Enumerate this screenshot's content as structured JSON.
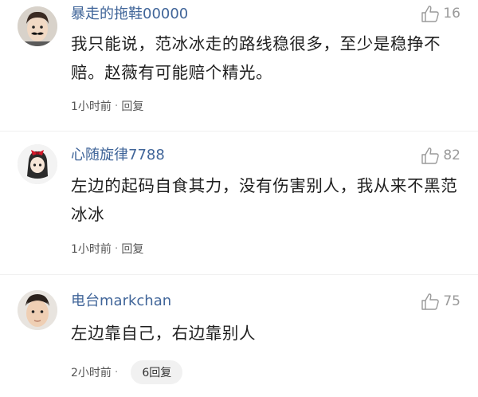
{
  "comments": [
    {
      "username": "暴走的拖鞋00000",
      "likes": "16",
      "text": "我只能说，范冰冰走的路线稳很多，至少是稳挣不赔。赵薇有可能赔个精光。",
      "time": "1小时前",
      "separator": "·",
      "reply_label": "回复"
    },
    {
      "username": "心随旋律7788",
      "likes": "82",
      "text": "左边的起码自食其力，没有伤害别人，我从来不黑范冰冰",
      "time": "1小时前",
      "separator": "·",
      "reply_label": "回复"
    },
    {
      "username": "电台markchan",
      "likes": "75",
      "text": "左边靠自己，右边靠别人",
      "time": "2小时前",
      "separator": "·",
      "reply_label": "6回复"
    }
  ],
  "colors": {
    "username": "#406599",
    "like": "#9a9a9a",
    "reply_pill_bg": "#f1f1f1"
  },
  "icons": {
    "like": "thumbs-up-icon"
  }
}
